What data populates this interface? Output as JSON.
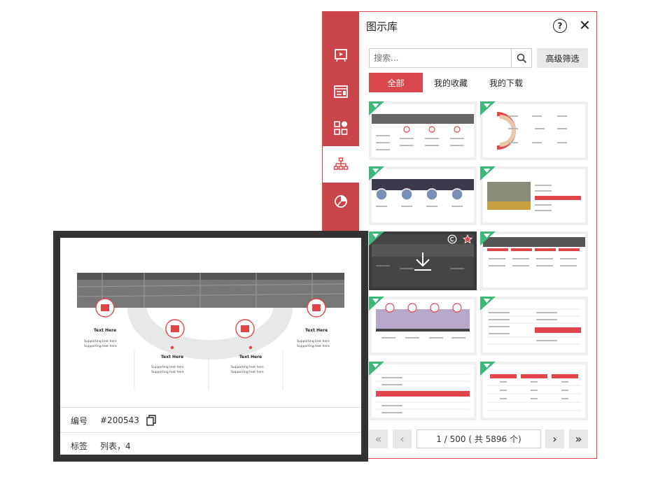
{
  "panel": {
    "title": "图示库",
    "help_symbol": "?",
    "close_symbol": "✕",
    "search_placeholder": "搜索...",
    "advanced_filter_label": "高级筛选",
    "tabs": [
      {
        "label": "全部",
        "active": true
      },
      {
        "label": "我的收藏",
        "active": false
      },
      {
        "label": "我的下载",
        "active": false
      }
    ],
    "sidebar_icons": [
      "presentation-icon",
      "text-layout-icon",
      "shapes-icon",
      "org-chart-icon",
      "pie-chart-icon"
    ],
    "pagination": {
      "current_page": "1",
      "summary": "/ 500 ( 共 5896 个)"
    }
  },
  "preview": {
    "id_label": "编号",
    "id_value": "#200543",
    "tags_label": "标签",
    "tags_value": "列表，4",
    "slide": {
      "items": [
        {
          "title": "Text Here",
          "bullets": [
            "Supporting text here",
            "Supporting text here"
          ]
        },
        {
          "title": "Text Here",
          "bullets": [
            "Supporting text here",
            "Supporting text here"
          ]
        },
        {
          "title": "Text Here",
          "bullets": [
            "Supporting text here",
            "Supporting text here"
          ]
        },
        {
          "title": "Text Here",
          "bullets": [
            "Supporting text here",
            "Supporting text here"
          ]
        }
      ]
    }
  },
  "colors": {
    "accent": "#d9484c",
    "gem": "#3cb878"
  }
}
